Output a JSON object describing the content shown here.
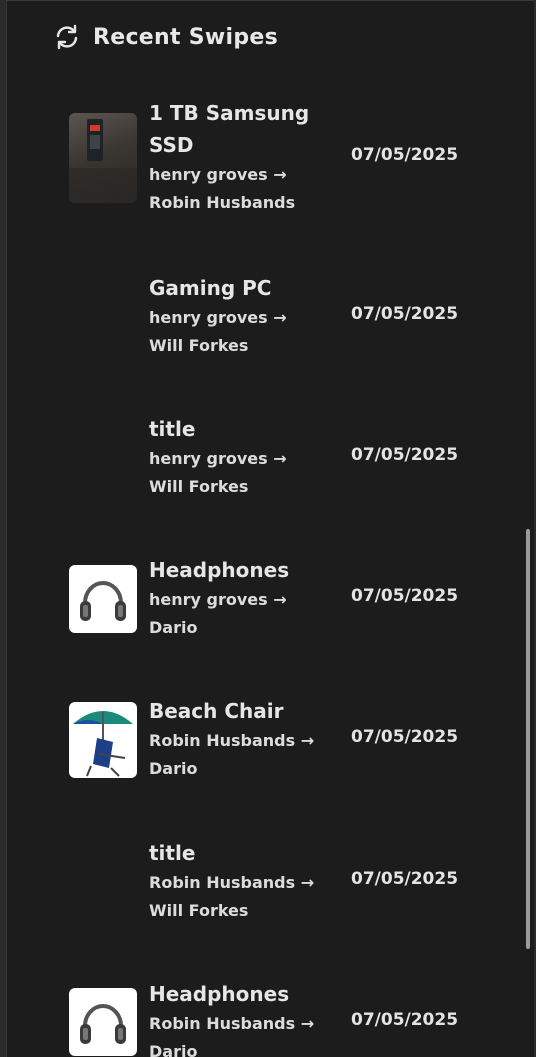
{
  "header": {
    "title": "Recent Swipes",
    "icon": "refresh-icon"
  },
  "swipes": [
    {
      "title": "1 TB Samsung SSD",
      "from": "henry groves",
      "to": "Robin Husbands",
      "arrow": "→",
      "date": "07/05/2025",
      "image": "ssd-photo"
    },
    {
      "title": "Gaming PC",
      "from": "henry groves",
      "to": "Will Forkes",
      "arrow": "→",
      "date": "07/05/2025",
      "image": ""
    },
    {
      "title": "title",
      "from": "henry groves",
      "to": "Will Forkes",
      "arrow": "→",
      "date": "07/05/2025",
      "image": ""
    },
    {
      "title": "Headphones",
      "from": "henry groves",
      "to": "Dario",
      "arrow": "→",
      "date": "07/05/2025",
      "image": "headphones-photo"
    },
    {
      "title": "Beach Chair",
      "from": "Robin Husbands",
      "to": "Dario",
      "arrow": "→",
      "date": "07/05/2025",
      "image": "beach-chair-photo"
    },
    {
      "title": "title",
      "from": "Robin Husbands",
      "to": "Will Forkes",
      "arrow": "→",
      "date": "07/05/2025",
      "image": ""
    },
    {
      "title": "Headphones",
      "from": "Robin Husbands",
      "to": "Dario",
      "arrow": "→",
      "date": "07/05/2025",
      "image": "headphones-photo"
    }
  ],
  "colors": {
    "background": "#1c1c1c",
    "text": "#e6e6e6"
  }
}
